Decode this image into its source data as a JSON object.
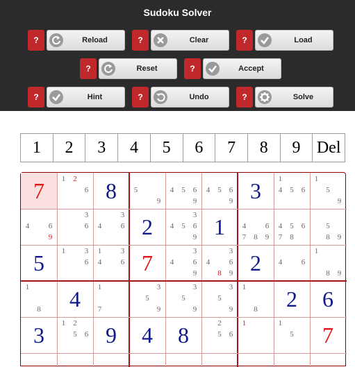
{
  "app_title": "Sudoku Solver",
  "help_label": "?",
  "toolbar_buttons": [
    {
      "name": "reload",
      "label": "Reload",
      "icon": "reload-icon"
    },
    {
      "name": "clear",
      "label": "Clear",
      "icon": "clear-icon"
    },
    {
      "name": "load",
      "label": "Load",
      "icon": "check-icon"
    },
    {
      "name": "reset",
      "label": "Reset",
      "icon": "reload-icon"
    },
    {
      "name": "accept",
      "label": "Accept",
      "icon": "check-icon"
    },
    {
      "name": "hint",
      "label": "Hint",
      "icon": "check-icon"
    },
    {
      "name": "undo",
      "label": "Undo",
      "icon": "undo-icon"
    },
    {
      "name": "solve",
      "label": "Solve",
      "icon": "gear-icon"
    }
  ],
  "number_keys": [
    "1",
    "2",
    "3",
    "4",
    "5",
    "6",
    "7",
    "8",
    "9",
    "Del"
  ],
  "colors": {
    "toolbar_bg": "#2b2b2b",
    "help_button": "#c0282c",
    "given_digit": "#111a8a",
    "user_digit": "#e01515",
    "grid_line": "#a01818",
    "selected_cell": "#fbe0e0"
  },
  "grid": {
    "selected_cell": [
      0,
      0
    ],
    "rows": [
      [
        {
          "value": "7",
          "kind": "user"
        },
        {
          "pm": [
            "1",
            "2",
            "",
            "",
            "",
            "6",
            "",
            "",
            ""
          ],
          "pm_red": [
            "2"
          ]
        },
        {
          "value": "8",
          "kind": "given"
        },
        {
          "pm": [
            "",
            "",
            "",
            "5",
            "",
            "",
            "",
            "",
            "9"
          ]
        },
        {
          "pm": [
            "",
            "",
            "",
            "4",
            "5",
            "6",
            "",
            "",
            "9"
          ]
        },
        {
          "pm": [
            "",
            "",
            "",
            "4",
            "5",
            "6",
            "",
            "",
            "9"
          ]
        },
        {
          "value": "3",
          "kind": "given"
        },
        {
          "pm": [
            "1",
            "",
            "",
            "4",
            "5",
            "6",
            "",
            "",
            ""
          ]
        },
        {
          "pm": [
            "1",
            "",
            "",
            "",
            "5",
            "",
            "",
            "",
            "9"
          ]
        }
      ],
      [
        {
          "pm": [
            "",
            "",
            "",
            "4",
            "",
            "6",
            "",
            "",
            "9"
          ],
          "pm_red": [
            "9"
          ]
        },
        {
          "pm": [
            "",
            "",
            "3",
            "",
            "",
            "6",
            "",
            "",
            ""
          ]
        },
        {
          "pm": [
            "",
            "",
            "3",
            "4",
            "",
            "6",
            "",
            "",
            ""
          ]
        },
        {
          "value": "2",
          "kind": "given"
        },
        {
          "pm": [
            "",
            "",
            "3",
            "4",
            "5",
            "6",
            "",
            "",
            "9"
          ]
        },
        {
          "value": "1",
          "kind": "given"
        },
        {
          "pm": [
            "",
            "",
            "",
            "4",
            "",
            "6",
            "7",
            "8",
            "9"
          ]
        },
        {
          "pm": [
            "",
            "",
            "",
            "4",
            "5",
            "6",
            "7",
            "8",
            ""
          ]
        },
        {
          "pm": [
            "",
            "",
            "",
            "",
            "5",
            "",
            "",
            "8",
            "9"
          ]
        }
      ],
      [
        {
          "value": "5",
          "kind": "given"
        },
        {
          "pm": [
            "1",
            "",
            "3",
            "",
            "",
            "6",
            "",
            "",
            ""
          ]
        },
        {
          "pm": [
            "1",
            "",
            "3",
            "4",
            "",
            "6",
            "",
            "",
            ""
          ]
        },
        {
          "value": "7",
          "kind": "user"
        },
        {
          "pm": [
            "",
            "",
            "3",
            "4",
            "",
            "6",
            "",
            "",
            "9"
          ]
        },
        {
          "pm": [
            "",
            "",
            "3",
            "4",
            "",
            "6",
            "",
            "8",
            "9"
          ],
          "pm_red": [
            "8"
          ]
        },
        {
          "value": "2",
          "kind": "given"
        },
        {
          "pm": [
            "",
            "",
            "",
            "4",
            "",
            "6",
            "",
            "",
            ""
          ]
        },
        {
          "pm": [
            "1",
            "",
            "",
            "",
            "",
            "",
            "",
            "8",
            "9"
          ]
        }
      ],
      [
        {
          "pm": [
            "1",
            "",
            "",
            "",
            "",
            "",
            "",
            "8",
            ""
          ]
        },
        {
          "value": "4",
          "kind": "given"
        },
        {
          "pm": [
            "1",
            "",
            "",
            "",
            "",
            "",
            "7",
            "",
            ""
          ]
        },
        {
          "pm": [
            "",
            "",
            "3",
            "",
            "5",
            "",
            "",
            "",
            "9"
          ]
        },
        {
          "pm": [
            "",
            "",
            "3",
            "",
            "5",
            "",
            "",
            "",
            "9"
          ]
        },
        {
          "pm": [
            "",
            "",
            "3",
            "",
            "5",
            "",
            "",
            "",
            "9"
          ]
        },
        {
          "pm": [
            "1",
            "",
            "",
            "",
            "",
            "",
            "",
            "8",
            ""
          ]
        },
        {
          "value": "2",
          "kind": "given"
        },
        {
          "value": "6",
          "kind": "given"
        }
      ],
      [
        {
          "value": "3",
          "kind": "given"
        },
        {
          "pm": [
            "1",
            "2",
            "",
            "",
            "5",
            "6",
            "",
            "",
            ""
          ]
        },
        {
          "value": "9",
          "kind": "given"
        },
        {
          "value": "4",
          "kind": "given"
        },
        {
          "value": "8",
          "kind": "given"
        },
        {
          "pm": [
            "",
            "2",
            "",
            "",
            "5",
            "6",
            "",
            "",
            ""
          ]
        },
        {
          "pm": [
            "1",
            "",
            "",
            "",
            "",
            "",
            "",
            "",
            ""
          ],
          "pm_red": [
            "1"
          ]
        },
        {
          "pm": [
            "1",
            "",
            "",
            "",
            "5",
            "",
            "",
            "",
            ""
          ]
        },
        {
          "value": "7",
          "kind": "user"
        }
      ]
    ]
  }
}
